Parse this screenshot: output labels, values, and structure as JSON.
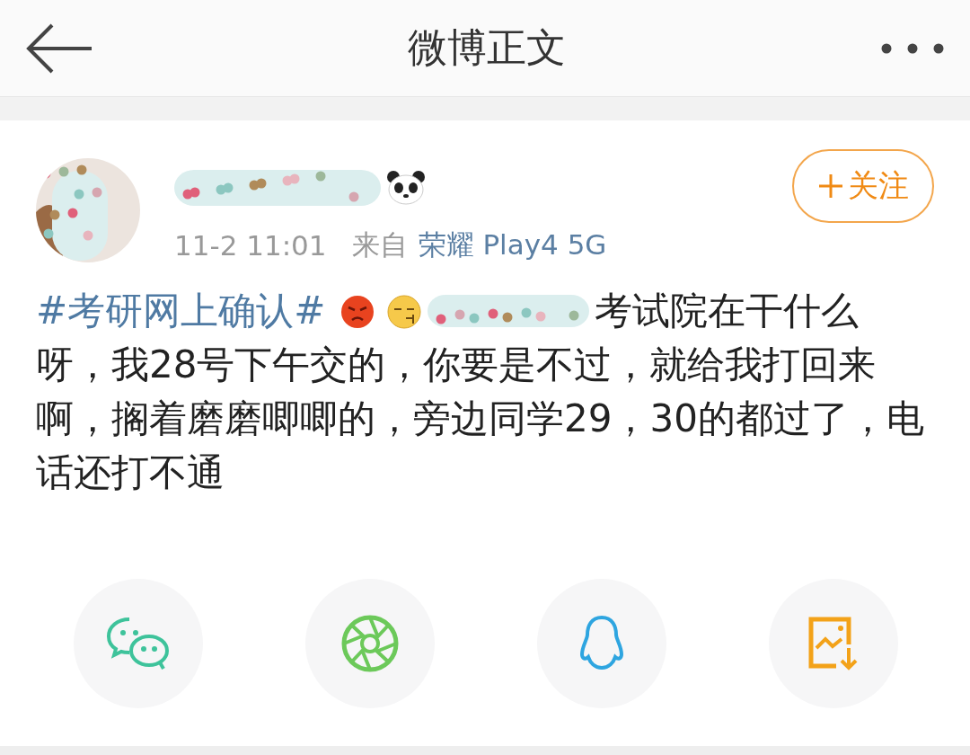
{
  "header": {
    "title": "微博正文"
  },
  "post": {
    "time": "11-2 11:01",
    "source_prefix": "来自",
    "source": "荣耀 Play4 5G",
    "follow": "关注",
    "hashtag": "#考研网上确认#",
    "body_start": "考试院在干什么",
    "body": "呀，我28号下午交的，你要是不过，就给我打回来啊，搁着磨磨唧唧的，旁边同学29，30的都过了，电话还打不通"
  }
}
